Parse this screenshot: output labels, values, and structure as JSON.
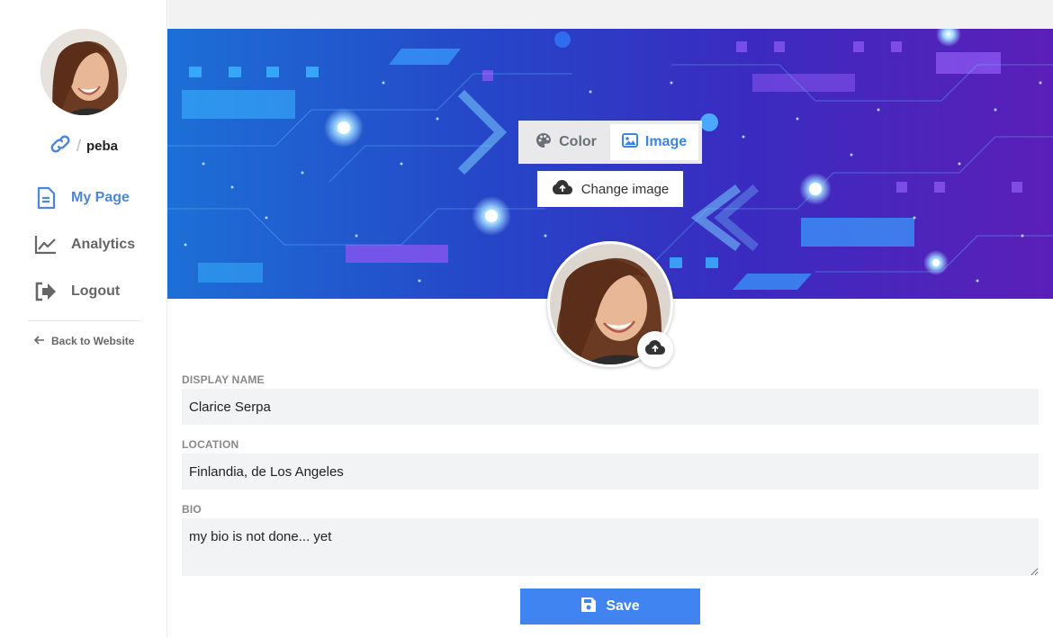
{
  "sidebar": {
    "username": "peba",
    "nav": [
      {
        "label": "My Page",
        "icon": "document-icon",
        "active": true
      },
      {
        "label": "Analytics",
        "icon": "chart-line-icon",
        "active": false
      },
      {
        "label": "Logout",
        "icon": "logout-icon",
        "active": false
      }
    ],
    "back_label": "Back to Website"
  },
  "banner": {
    "options": [
      {
        "label": "Color",
        "icon": "palette-icon",
        "selected": false
      },
      {
        "label": "Image",
        "icon": "image-icon",
        "selected": true
      }
    ],
    "change_image_label": "Change image"
  },
  "form": {
    "display_name": {
      "label": "DISPLAY NAME",
      "value": "Clarice Serpa"
    },
    "location": {
      "label": "LOCATION",
      "value": "Finlandia, de Los Angeles"
    },
    "bio": {
      "label": "BIO",
      "value": "my bio is not done... yet"
    },
    "save_label": "Save"
  },
  "colors": {
    "accent": "#3f84f0",
    "nav_active": "#4d86d8",
    "input_bg": "#f2f3f5"
  }
}
